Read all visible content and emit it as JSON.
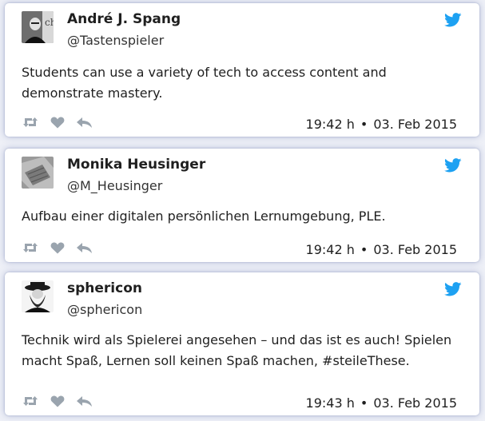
{
  "accent_color": "#1da1f2",
  "action_icon_color": "#9aa4ae",
  "tweets": [
    {
      "author": "André J. Spang",
      "handle": "@Tastenspieler",
      "text": "Students can use a variety of tech to access content and demonstrate mastery.",
      "time": "19:42 h",
      "date": "03. Feb 2015",
      "avatar_icon": "profile-photo-bw-man",
      "actions": [
        "retweet-icon",
        "like-icon",
        "reply-icon"
      ]
    },
    {
      "author": "Monika Heusinger",
      "handle": "@M_Heusinger",
      "text": "Aufbau einer digitalen persönlichen Lernumgebung, PLE.",
      "time": "19:42 h",
      "date": "03. Feb 2015",
      "avatar_icon": "profile-photo-bw-papers",
      "actions": [
        "retweet-icon",
        "like-icon",
        "reply-icon"
      ]
    },
    {
      "author": "sphericon",
      "handle": "@sphericon",
      "text": "Technik wird als Spielerei angesehen – und das ist es auch! Spielen macht Spaß, Lernen soll keinen Spaß machen, #steileThese.",
      "time": "19:43 h",
      "date": "03. Feb 2015",
      "avatar_icon": "profile-photo-bearded-man-hat",
      "actions": [
        "retweet-icon",
        "like-icon",
        "reply-icon"
      ]
    }
  ]
}
